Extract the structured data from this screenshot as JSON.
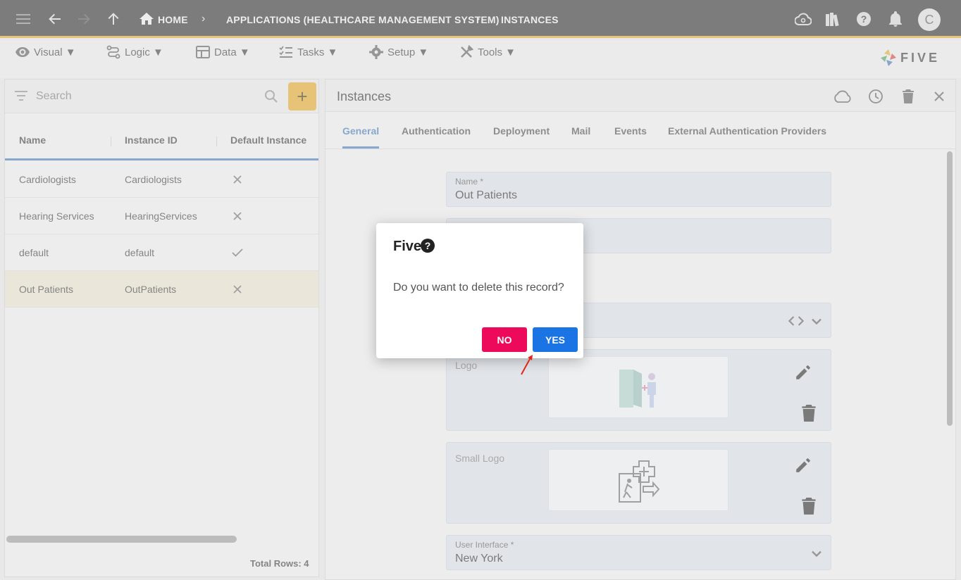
{
  "breadcrumb": {
    "home": "HOME",
    "app": "APPLICATIONS (HEALTHCARE MANAGEMENT SYSTEM)",
    "current": "INSTANCES"
  },
  "user": {
    "avatar_letter": "C"
  },
  "menu": {
    "visual": "Visual ▼",
    "logic": "Logic ▼",
    "data": "Data ▼",
    "tasks": "Tasks ▼",
    "setup": "Setup ▼",
    "tools": "Tools ▼"
  },
  "logo_text": "FIVE",
  "left": {
    "search_placeholder": "Search",
    "columns": [
      "Name",
      "Instance ID",
      "Default Instance"
    ],
    "rows": [
      {
        "name": "Cardiologists",
        "id": "Cardiologists",
        "default": "cross"
      },
      {
        "name": "Hearing Services",
        "id": "HearingServices",
        "default": "cross"
      },
      {
        "name": "default",
        "id": "default",
        "default": "check"
      },
      {
        "name": "Out Patients",
        "id": "OutPatients",
        "default": "cross"
      }
    ],
    "total_rows": "Total Rows: 4"
  },
  "right": {
    "title": "Instances",
    "tabs": [
      "General",
      "Authentication",
      "Deployment",
      "Mail",
      "Events",
      "External Authentication Providers"
    ],
    "fields": {
      "name_label": "Name *",
      "name_value": "Out Patients",
      "logo_label": "Logo",
      "small_logo_label": "Small Logo",
      "ui_label": "User Interface *",
      "ui_value": "New York"
    }
  },
  "dialog": {
    "title": "Five",
    "message": "Do you want to delete this record?",
    "no": "NO",
    "yes": "YES"
  },
  "colors": {
    "topbar": "#262626",
    "accent": "#e2a91f",
    "link": "#3a73b7",
    "no_button": "#ee0a5a",
    "yes_button": "#1b74e4"
  }
}
